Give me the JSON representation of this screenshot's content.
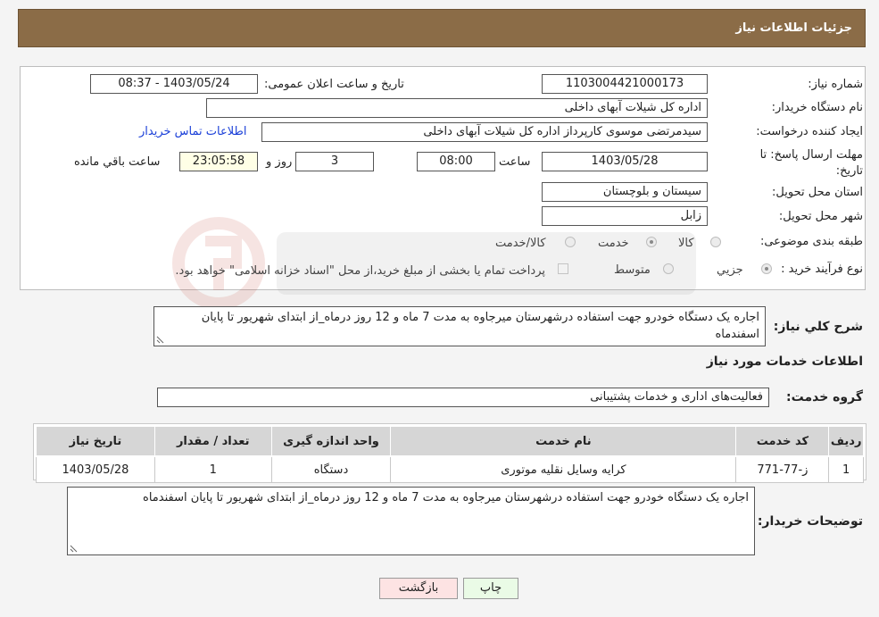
{
  "header": {
    "title": "جزئیات اطلاعات نیاز"
  },
  "labels": {
    "need_number": "شماره نیاز:",
    "announce_datetime": "تاریخ و ساعت اعلان عمومی:",
    "buyer_org": "نام دستگاه خریدار:",
    "requester": "ایجاد کننده درخواست:",
    "deadline": "مهلت ارسال پاسخ: تا",
    "deadline_date": "تاریخ:",
    "time_word": "ساعت",
    "days_word": "روز و",
    "remaining_word": "ساعت باقي مانده",
    "province": "استان محل تحویل:",
    "city": "شهر محل تحویل:",
    "category": "طبقه بندی موضوعی:",
    "process_type": "نوع فرآیند خرید :",
    "general_desc": "شرح کلي نياز:",
    "services_info": "اطلاعات خدمات مورد نیاز",
    "service_group": "گروه خدمت:",
    "buyer_notes": "توضیحات خریدار:"
  },
  "fields": {
    "need_number": "1103004421000173",
    "announce_datetime": "1403/05/24 - 08:37",
    "buyer_org": "اداره کل شیلات آبهای داخلی",
    "requester": "سیدمرتضی موسوی کارپرداز اداره کل شیلات آبهای داخلی",
    "contact_link": "اطلاعات تماس خریدار",
    "deadline_date": "1403/05/28",
    "deadline_time": "08:00",
    "days": "3",
    "remaining_time": "23:05:58",
    "province": "سیستان و بلوچستان",
    "city": "زابل"
  },
  "category_options": [
    {
      "label": "کالا",
      "selected": false
    },
    {
      "label": "خدمت",
      "selected": true
    },
    {
      "label": "کالا/خدمت",
      "selected": false
    }
  ],
  "process_options": [
    {
      "label": "جزيي",
      "selected": true
    },
    {
      "label": "متوسط",
      "selected": false
    }
  ],
  "payment_note": "پرداخت تمام یا بخشی از مبلغ خرید،از محل \"اسناد خزانه اسلامی\" خواهد بود.",
  "general_desc_text": "اجاره یک دستگاه خودرو جهت استفاده درشهرستان میرجاوه به مدت 7 ماه و 12 روز درماه_از ابتدای شهریور تا پایان اسفندماه",
  "service_group_value": "فعالیت‌های اداری و خدمات پشتیبانی",
  "table": {
    "headers": [
      "ردیف",
      "کد خدمت",
      "نام خدمت",
      "واحد اندازه گیری",
      "تعداد / مقدار",
      "تاریخ نیاز"
    ],
    "rows": [
      [
        "1",
        "ز-77-771",
        "کرایه وسایل نقلیه موتوری",
        "دستگاه",
        "1",
        "1403/05/28"
      ]
    ]
  },
  "buyer_notes_text": "اجاره یک دستگاه خودرو جهت استفاده درشهرستان میرجاوه به مدت 7 ماه و 12 روز درماه_از ابتدای شهریور تا پایان اسفندماه",
  "buttons": {
    "print": "چاپ",
    "back": "بازگشت"
  },
  "colors": {
    "header_bg": "#8b6c47",
    "link": "#1a3fd8",
    "remaining_bg": "#ffffe6"
  }
}
